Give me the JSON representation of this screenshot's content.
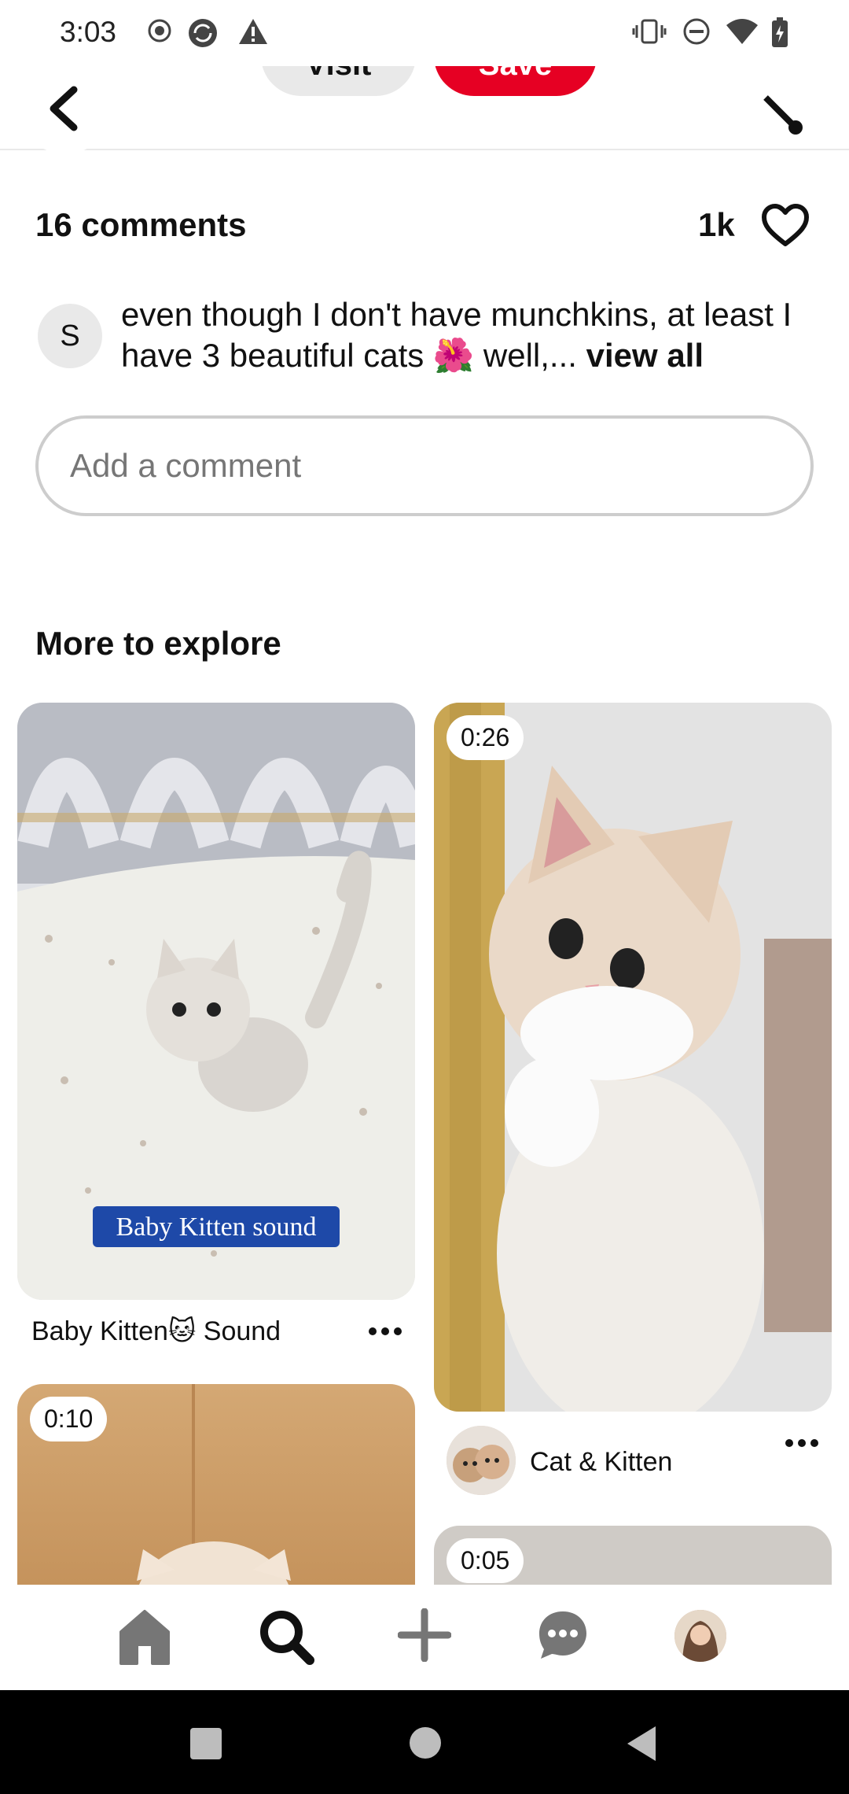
{
  "status_bar": {
    "time": "3:03"
  },
  "header": {
    "visit_label": "Visit",
    "save_label": "Save"
  },
  "comments": {
    "count_label": "16 comments",
    "likes": "1k",
    "top_comment": {
      "avatar_letter": "S",
      "text": "even though I don't have munchkins, at least I have 3 beautiful cats 🌺 well,...",
      "more_label": "view all"
    },
    "input_placeholder": "Add a comment"
  },
  "explore": {
    "title": "More to explore",
    "pins": [
      {
        "title": "Baby Kitten🐱 Sound",
        "overlay_text": "Baby Kitten sound"
      },
      {
        "duration": "0:26",
        "author": "Cat & Kitten"
      },
      {
        "duration": "0:10"
      },
      {
        "duration": "0:05"
      }
    ]
  },
  "colors": {
    "save": "#e60023",
    "text": "#111111",
    "muted": "#767676"
  }
}
